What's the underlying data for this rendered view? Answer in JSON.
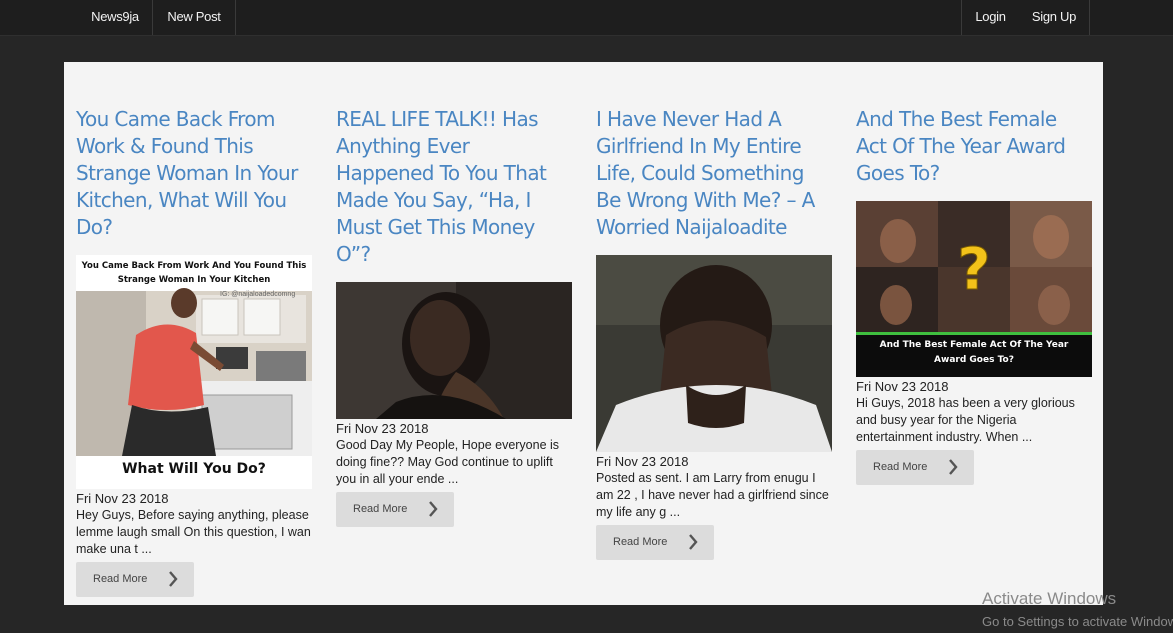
{
  "nav": {
    "brand": "News9ja",
    "new_post": "New Post",
    "login": "Login",
    "signup": "Sign Up"
  },
  "posts": [
    {
      "title": "You Came Back From Work & Found This Strange Woman In Your Kitchen, What Will You Do?",
      "image_caption_top": "You Came Back From Work And You Found This Strange Woman In Your Kitchen",
      "image_watermark": "IG: @naijaloadedcomng",
      "image_caption_bottom": "What Will You Do?",
      "date": "Fri Nov 23 2018",
      "excerpt": "Hey Guys, Before saying anything, please lemme laugh small On this question, I wan make una t ...",
      "read_more": "Read More",
      "read_more_icon": "chevron-right-icon"
    },
    {
      "title": "REAL LIFE TALK!! Has Anything Ever Happened To You That Made You Say, “Ha, I Must Get This Money O”?",
      "date": "Fri Nov 23 2018",
      "excerpt": "Good Day My People, Hope everyone is doing fine?? May God continue to uplift you in all your ende ...",
      "read_more": "Read More",
      "read_more_icon": "chevron-right-icon"
    },
    {
      "title": "I Have Never Had A Girlfriend In My Entire Life, Could Something Be Wrong With Me? – A Worried Naijaloadite",
      "date": "Fri Nov 23 2018",
      "excerpt": "Posted as sent. I am Larry from enugu I am 22 , I have never had a girlfriend since my life any g ...",
      "read_more": "Read More",
      "read_more_icon": "chevron-right-icon"
    },
    {
      "title": "And The Best Female Act Of The Year Award Goes To?",
      "image_caption": "And The Best Female Act Of The Year Award Goes To?",
      "date": "Fri Nov 23 2018",
      "excerpt": "Hi Guys, 2018 has been a very glorious and busy year for the Nigeria entertainment industry. When ...",
      "read_more": "Read More",
      "read_more_icon": "chevron-right-icon"
    }
  ],
  "watermark": {
    "title": "Activate Windows",
    "subtitle": "Go to Settings to activate Windows."
  },
  "colors": {
    "title_link": "#4a86c2",
    "page_bg": "#262626",
    "panel_bg": "#f4f4f4",
    "navbar_bg": "#1e1e1e",
    "button_bg": "#dcdcdc"
  }
}
